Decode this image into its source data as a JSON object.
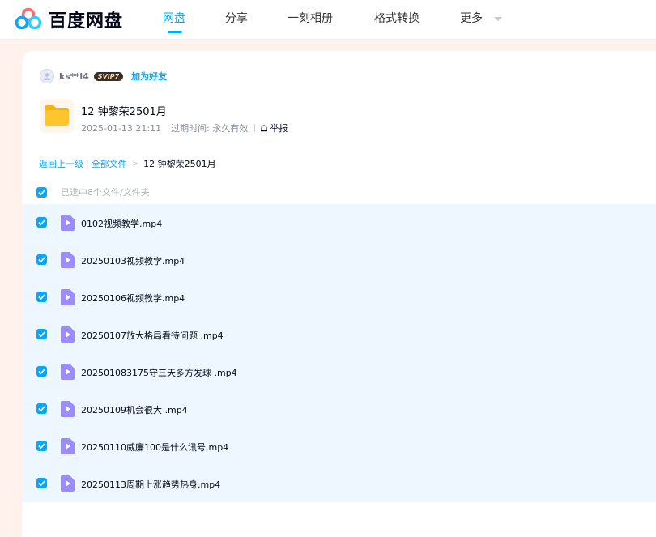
{
  "header": {
    "logo_text": "百度网盘",
    "nav": [
      {
        "label": "网盘",
        "active": true
      },
      {
        "label": "分享",
        "active": false
      },
      {
        "label": "一刻相册",
        "active": false
      },
      {
        "label": "格式转换",
        "active": false
      },
      {
        "label": "更多",
        "active": false
      }
    ]
  },
  "share": {
    "owner": "ks**l4",
    "vip_badge": "SVIP7",
    "add_friend": "加为好友",
    "folder_title": "12 钟黎荣2501月",
    "date": "2025-01-13 21:11",
    "expiry": "过期时间: 永久有效",
    "report": "举报"
  },
  "breadcrumb": {
    "back": "返回上一级",
    "all_files": "全部文件",
    "current": "12 钟黎荣2501月"
  },
  "selection": {
    "label": "已选中8个文件/文件夹"
  },
  "files": [
    {
      "name": "0102视频教学.mp4",
      "checked": true
    },
    {
      "name": "20250103视频教学.mp4",
      "checked": true
    },
    {
      "name": "20250106视频教学.mp4",
      "checked": true
    },
    {
      "name": "20250107放大格局看待问题 .mp4",
      "checked": true
    },
    {
      "name": "202501083175守三天多方发球 .mp4",
      "checked": true
    },
    {
      "name": "20250109机会很大 .mp4",
      "checked": true
    },
    {
      "name": "20250110威廉100是什么讯号.mp4",
      "checked": true
    },
    {
      "name": "20250113周期上涨趋势热身.mp4",
      "checked": true
    }
  ],
  "colors": {
    "accent": "#06a7ff",
    "page_background": "#fff2ec",
    "list_highlight": "#eef7ff",
    "video_icon": "#9b8cff"
  }
}
